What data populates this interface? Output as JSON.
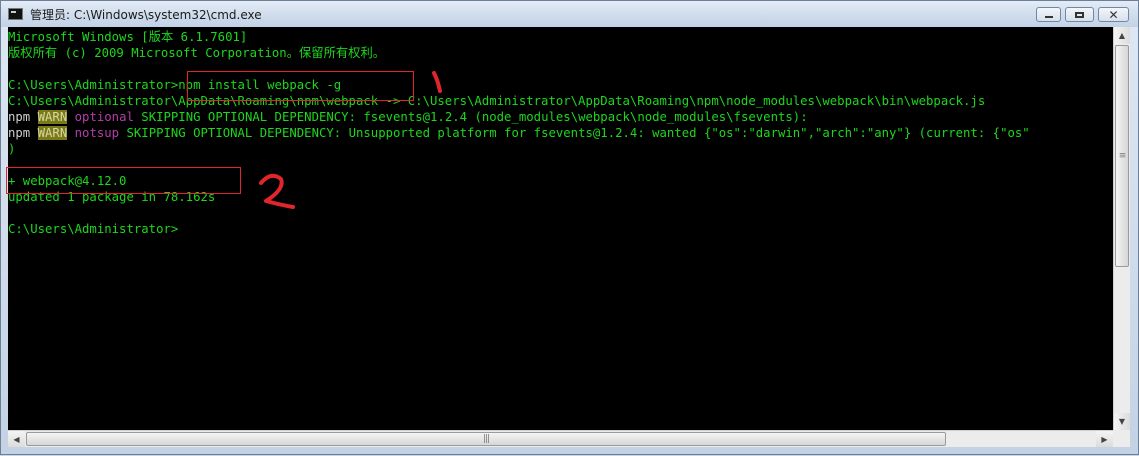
{
  "window": {
    "title": "管理员: C:\\Windows\\system32\\cmd.exe"
  },
  "console": {
    "lines": {
      "l1": "Microsoft Windows [版本 6.1.7601]",
      "l2": "版权所有 (c) 2009 Microsoft Corporation。保留所有权利。",
      "l3": "C:\\Users\\Administrator>npm install webpack -g",
      "l4": "C:\\Users\\Administrator\\AppData\\Roaming\\npm\\webpack -> C:\\Users\\Administrator\\AppData\\Roaming\\npm\\node_modules\\webpack\\bin\\webpack.js",
      "l5_prefix": "npm ",
      "l5_warn": "WARN",
      "l5_tag": " optional",
      "l5_rest": " SKIPPING OPTIONAL DEPENDENCY: fsevents@1.2.4 (node_modules\\webpack\\node_modules\\fsevents):",
      "l6_prefix": "npm ",
      "l6_warn": "WARN",
      "l6_tag": " notsup",
      "l6_rest": " SKIPPING OPTIONAL DEPENDENCY: Unsupported platform for fsevents@1.2.4: wanted {\"os\":\"darwin\",\"arch\":\"any\"} (current: {\"os\"",
      "l7": ")",
      "l8": "+ webpack@4.12.0",
      "l9": "updated 1 package in 78.162s",
      "l10": "C:\\Users\\Administrator>"
    }
  },
  "annotations": {
    "mark1": "1",
    "mark2": "2"
  },
  "colors": {
    "console_text": "#1ed61e",
    "warn_bg": "#7a7a1a",
    "tag": "#b43ea8",
    "highlight_box": "#e0262b"
  }
}
